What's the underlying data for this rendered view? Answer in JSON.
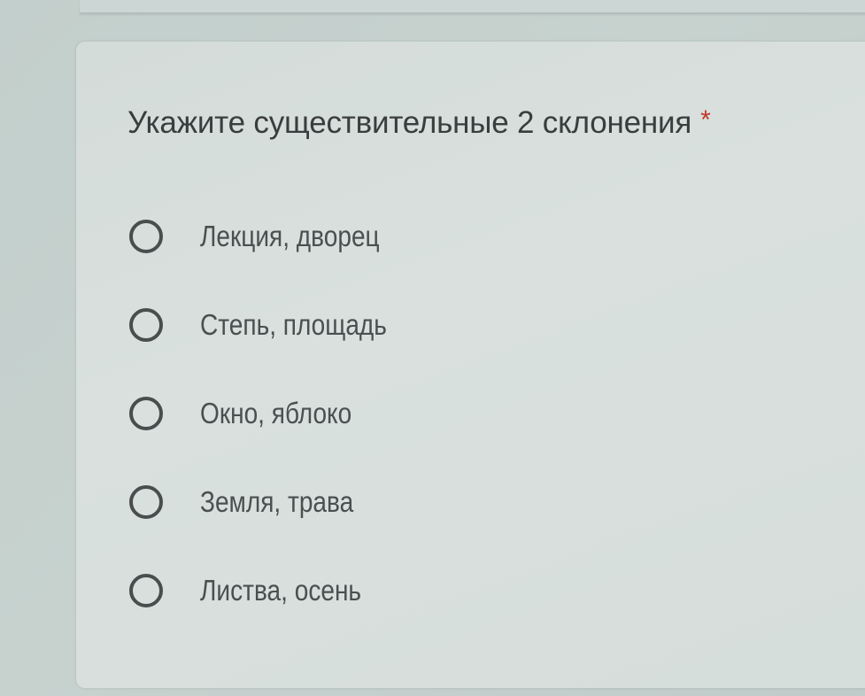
{
  "question": {
    "title": "Укажите существительные 2 склонения",
    "required_marker": "*",
    "options": [
      {
        "label": "Лекция, дворец",
        "selected": false
      },
      {
        "label": "Степь, площадь",
        "selected": false
      },
      {
        "label": "Окно, яблоко",
        "selected": false
      },
      {
        "label": "Земля, трава",
        "selected": false
      },
      {
        "label": "Листва, осень",
        "selected": false
      }
    ]
  }
}
